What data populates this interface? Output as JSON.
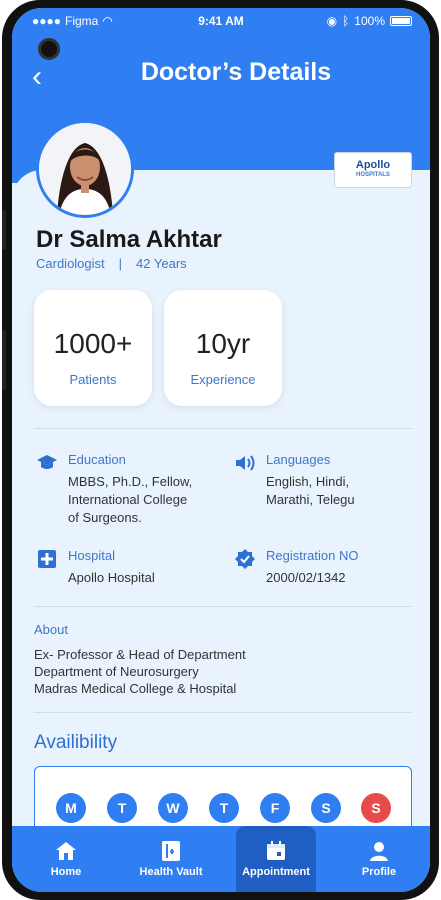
{
  "status_bar": {
    "carrier": "Figma",
    "time": "9:41 AM",
    "battery": "100%"
  },
  "header": {
    "title": "Doctor’s Details"
  },
  "hospital_logo": {
    "name": "Apollo",
    "subtitle": "HOSPITALS"
  },
  "doctor": {
    "name": "Dr Salma Akhtar",
    "specialty": "Cardiologist",
    "separator": "|",
    "age": "42 Years"
  },
  "stats": [
    {
      "value": "1000+",
      "label": "Patients"
    },
    {
      "value": "10yr",
      "label": "Experience"
    }
  ],
  "info": {
    "education": {
      "label": "Education",
      "lines": [
        "MBBS, Ph.D., Fellow,",
        "International College",
        "of Surgeons."
      ]
    },
    "languages": {
      "label": "Languages",
      "lines": [
        "English, Hindi,",
        "Marathi, Telegu"
      ]
    },
    "hospital": {
      "label": "Hospital",
      "value": "Apollo Hospital"
    },
    "registration": {
      "label": "Registration NO",
      "value": "2000/02/1342"
    }
  },
  "about": {
    "label": "About",
    "lines": [
      "Ex- Professor & Head of Department",
      "Department of Neurosurgery",
      "Madras Medical College & Hospital"
    ]
  },
  "availability": {
    "title": "Availibility",
    "days": [
      "M",
      "T",
      "W",
      "T",
      "F",
      "S",
      "S"
    ]
  },
  "nav": [
    {
      "label": "Home",
      "icon": "home-icon"
    },
    {
      "label": "Health Vault",
      "icon": "vault-icon"
    },
    {
      "label": "Appointment",
      "icon": "calendar-icon"
    },
    {
      "label": "Profile",
      "icon": "profile-icon"
    }
  ],
  "colors": {
    "primary": "#2f7ff2",
    "accent_text": "#3f76c9",
    "off_day": "#e94b4b",
    "background": "#e9f3fd"
  }
}
